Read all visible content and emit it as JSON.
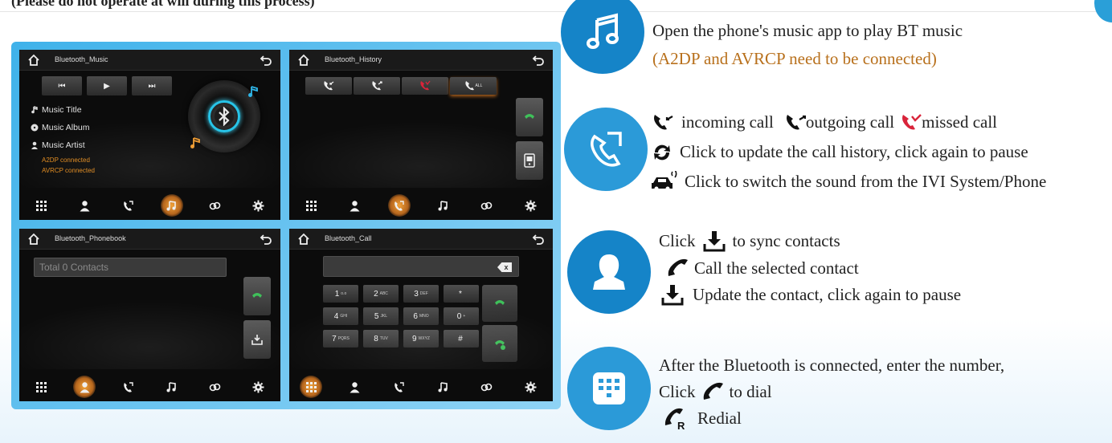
{
  "header": {
    "note": "(Please do not operate at will during this process)"
  },
  "screens": {
    "music": {
      "title": "Bluetooth_Music",
      "controls": {
        "prev": "⏮",
        "play": "▶",
        "next": "⏭"
      },
      "track_title": "Music Title",
      "album": "Music Album",
      "artist": "Music Artist",
      "a2dp_status": "A2DP connected",
      "avrcp_status": "AVRCP connected"
    },
    "history": {
      "title": "Bluetooth_History",
      "filter_all": "ALL"
    },
    "phonebook": {
      "title": "Bluetooth_Phonebook",
      "search_placeholder": "Total 0 Contacts"
    },
    "call": {
      "title": "Bluetooth_Call",
      "keys": [
        {
          "d": "1",
          "s": "o.o"
        },
        {
          "d": "2",
          "s": "ABC"
        },
        {
          "d": "3",
          "s": "DEF"
        },
        {
          "d": "*",
          "s": ""
        },
        {
          "d": "4",
          "s": "GHI"
        },
        {
          "d": "5",
          "s": "JKL"
        },
        {
          "d": "6",
          "s": "MNO"
        },
        {
          "d": "0",
          "s": "+"
        },
        {
          "d": "7",
          "s": "PQRS"
        },
        {
          "d": "8",
          "s": "TUV"
        },
        {
          "d": "9",
          "s": "WXYZ"
        },
        {
          "d": "#",
          "s": ""
        }
      ]
    }
  },
  "instructions": {
    "music": {
      "line1": "Open the phone's music app to play BT music",
      "line2": "(A2DP and AVRCP need to be connected)"
    },
    "history": {
      "incoming": "incoming call",
      "outgoing": "outgoing call",
      "missed": "missed call",
      "update": "Click to update the call history, click again to pause",
      "switch": "Click to switch the sound from the IVI System/Phone"
    },
    "phonebook": {
      "click": "Click",
      "sync": "to sync contacts",
      "call_selected": "Call the selected contact",
      "update": "Update the contact, click again to pause"
    },
    "dial": {
      "line1": "After the Bluetooth is connected, enter the number,",
      "click": "Click",
      "to_dial": "to dial",
      "redial": "Redial"
    }
  },
  "colors": {
    "accent_blue": "#1584c8",
    "frame_blue": "#3fb2ea",
    "orange_text": "#b8701c",
    "active_nav": "#f2a33a",
    "missed_red": "#d9243a"
  },
  "icons": [
    "home-icon",
    "back-icon",
    "music-note-icon",
    "phone-icon",
    "contact-icon",
    "dialpad-icon",
    "link-icon",
    "gear-icon",
    "bluetooth-icon",
    "download-icon",
    "car-sound-icon",
    "refresh-icon",
    "redial-icon"
  ]
}
